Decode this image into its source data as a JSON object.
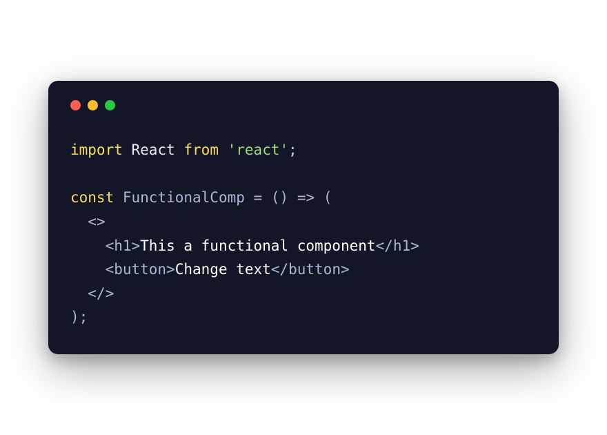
{
  "colors": {
    "bg": "#131627",
    "red": "#ff5f56",
    "yellow": "#ffbd2e",
    "green": "#27c93f"
  },
  "code": {
    "line1": {
      "kw1": "import",
      "sp1": " ",
      "ident": "React",
      "sp2": " ",
      "kw2": "from",
      "sp3": " ",
      "str": "'react'",
      "semi": ";"
    },
    "blank": " ",
    "line2": {
      "kw": "const",
      "sp1": " ",
      "fn": "FunctionalComp",
      "sp2": " ",
      "eq": "=",
      "sp3": " ",
      "paren1": "()",
      "sp4": " ",
      "arrow": "=>",
      "sp5": " ",
      "paren2": "("
    },
    "line3": {
      "indent": "  ",
      "frag": "<>"
    },
    "line4": {
      "indent": "    ",
      "open": "<h1>",
      "text": "This a functional component",
      "close": "</h1>"
    },
    "line5": {
      "indent": "    ",
      "open": "<button>",
      "text": "Change text",
      "close": "</button>"
    },
    "line6": {
      "indent": "  ",
      "frag": "</>"
    },
    "line7": {
      "paren": ");"
    }
  }
}
